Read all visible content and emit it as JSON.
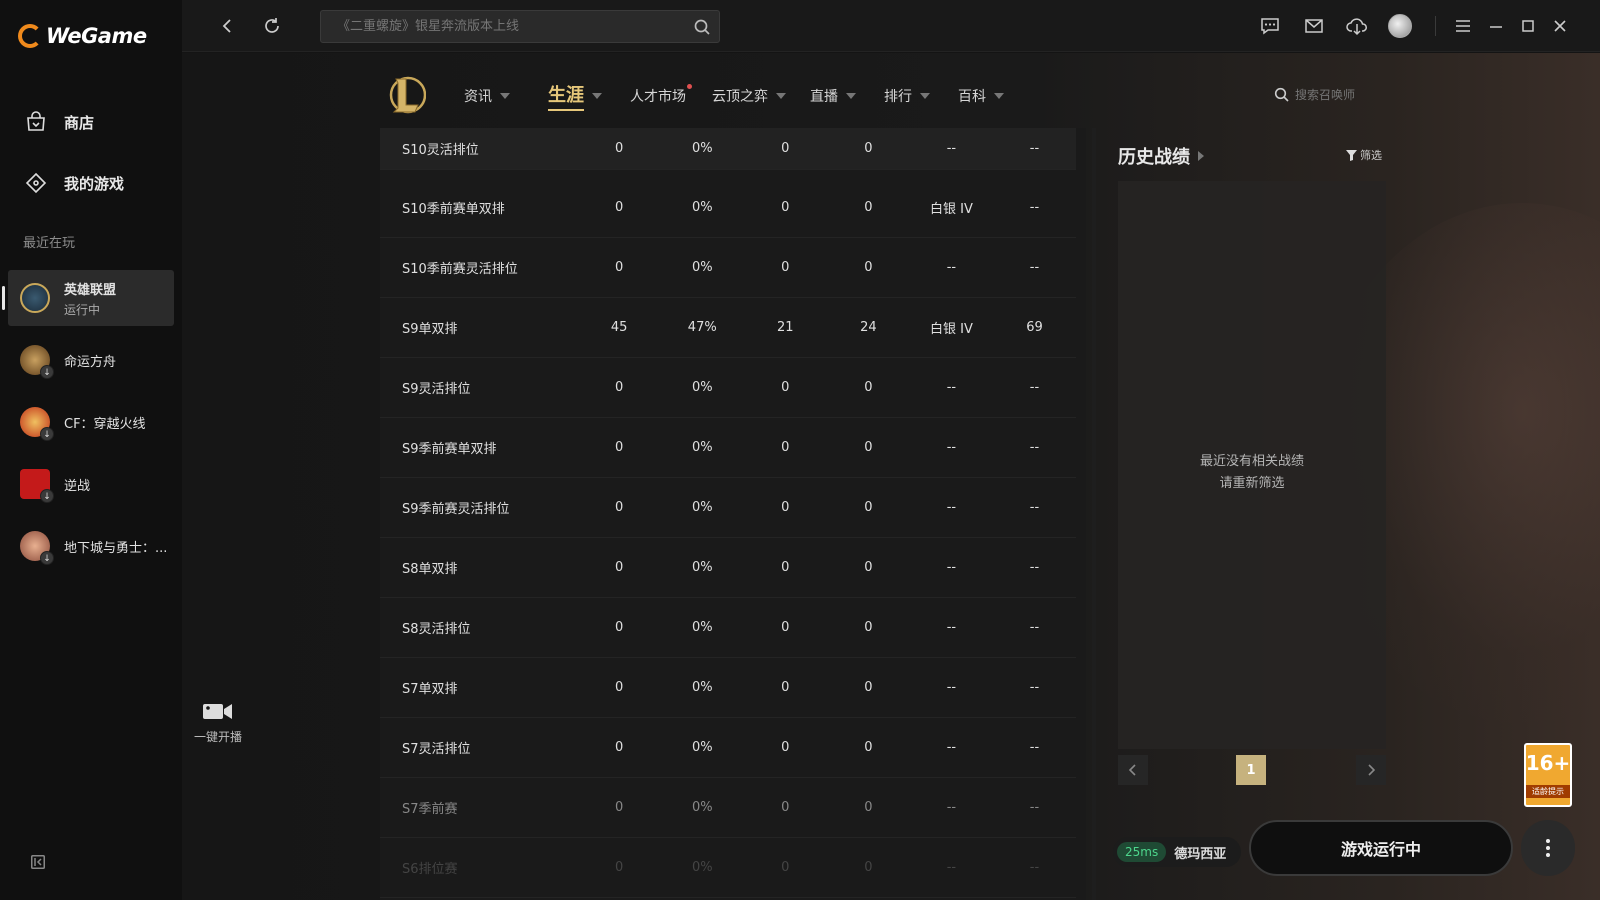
{
  "app": {
    "logo_text": "WeGame"
  },
  "sidebar": {
    "store": "商店",
    "my_games": "我的游戏",
    "recent_label": "最近在玩",
    "games": [
      {
        "name": "英雄联盟",
        "status": "运行中",
        "color": "#c9a85a",
        "active": true
      },
      {
        "name": "命运方舟",
        "color": "#8a6a40"
      },
      {
        "name": "CF：穿越火线",
        "color": "#c84020"
      },
      {
        "name": "逆战",
        "color": "#c02020"
      },
      {
        "name": "地下城与勇士：...",
        "color": "#a06050"
      }
    ]
  },
  "topbar": {
    "search_placeholder": "《二重螺旋》银星奔流版本上线"
  },
  "game_nav": {
    "items": [
      {
        "label": "资讯",
        "caret": true
      },
      {
        "label": "生涯",
        "caret": true,
        "active": true
      },
      {
        "label": "人才市场",
        "dot": true
      },
      {
        "label": "云顶之弈",
        "caret": true
      },
      {
        "label": "直播",
        "caret": true
      },
      {
        "label": "排行",
        "caret": true
      },
      {
        "label": "百科",
        "caret": true
      }
    ],
    "summoner_search_placeholder": "搜索召唤师"
  },
  "rank_table": {
    "rows": [
      [
        "S10灵活排位",
        "0",
        "0%",
        "0",
        "0",
        "--",
        "--"
      ],
      [
        "S10季前赛单双排",
        "0",
        "0%",
        "0",
        "0",
        "白银 IV",
        "--"
      ],
      [
        "S10季前赛灵活排位",
        "0",
        "0%",
        "0",
        "0",
        "--",
        "--"
      ],
      [
        "S9单双排",
        "45",
        "47%",
        "21",
        "24",
        "白银 IV",
        "69"
      ],
      [
        "S9灵活排位",
        "0",
        "0%",
        "0",
        "0",
        "--",
        "--"
      ],
      [
        "S9季前赛单双排",
        "0",
        "0%",
        "0",
        "0",
        "--",
        "--"
      ],
      [
        "S9季前赛灵活排位",
        "0",
        "0%",
        "0",
        "0",
        "--",
        "--"
      ],
      [
        "S8单双排",
        "0",
        "0%",
        "0",
        "0",
        "--",
        "--"
      ],
      [
        "S8灵活排位",
        "0",
        "0%",
        "0",
        "0",
        "--",
        "--"
      ],
      [
        "S7单双排",
        "0",
        "0%",
        "0",
        "0",
        "--",
        "--"
      ],
      [
        "S7灵活排位",
        "0",
        "0%",
        "0",
        "0",
        "--",
        "--"
      ],
      [
        "S7季前赛",
        "0",
        "0%",
        "0",
        "0",
        "--",
        "--"
      ],
      [
        "S6排位赛",
        "0",
        "0%",
        "0",
        "0",
        "--",
        "--"
      ]
    ]
  },
  "history": {
    "title": "历史战绩",
    "filter_label": "筛选",
    "empty_line1": "最近没有相关战绩",
    "empty_line2": "请重新筛选",
    "page": "1"
  },
  "stream": {
    "label": "一键开播"
  },
  "server": {
    "ping": "25ms",
    "name": "德玛西亚"
  },
  "play_button": "游戏运行中",
  "age_badge": {
    "rating": "16+",
    "caption": "适龄提示"
  }
}
